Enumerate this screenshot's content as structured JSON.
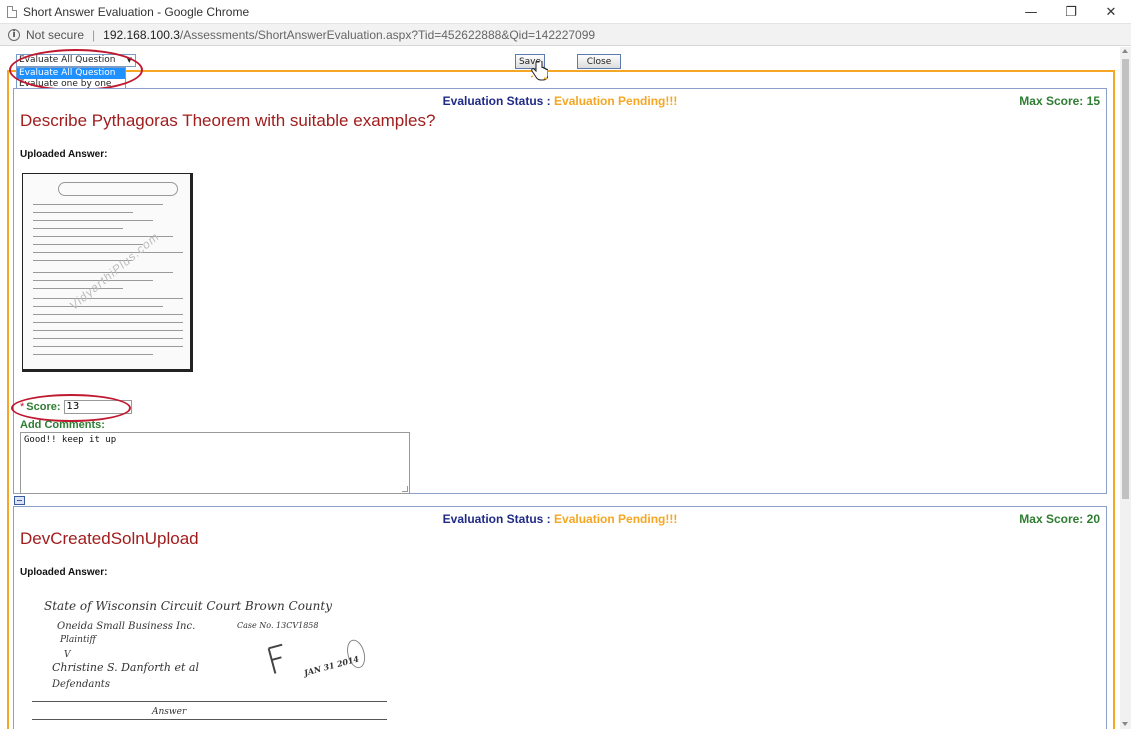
{
  "window": {
    "title": "Short Answer Evaluation - Google Chrome",
    "controls": {
      "minimize": "—",
      "restore": "❐",
      "close": "✕"
    }
  },
  "address": {
    "security": "Not secure",
    "host": "192.168.100.3",
    "path": "/Assessments/ShortAnswerEvaluation.aspx?Tid=452622888&Qid=142227099"
  },
  "toolbar": {
    "mode_selected": "Evaluate All Question",
    "mode_options": [
      "Evaluate All Question",
      "Evaluate one by one"
    ],
    "save_label": "Save",
    "close_label": "Close"
  },
  "questions": [
    {
      "status_label": "Evaluation Status :",
      "status_value": "Evaluation Pending!!!",
      "max_score": "Max Score: 15",
      "title": "Describe Pythagoras Theorem with suitable examples?",
      "uploaded_label": "Uploaded Answer:",
      "watermark": "VidyarthiPlus.com",
      "score_star": "*",
      "score_label": "Score:",
      "score_value": "13",
      "comments_label": "Add Comments:",
      "comments_value": "Good!! keep it up"
    },
    {
      "status_label": "Evaluation Status :",
      "status_value": "Evaluation Pending!!!",
      "max_score": "Max Score: 20",
      "title": "DevCreatedSolnUpload",
      "uploaded_label": "Uploaded Answer:",
      "scan_lines": [
        "State of Wisconsin   Circuit Court   Brown County",
        "Oneida Small Business Inc.",
        "Case No. 13CV1858",
        "Plaintiff",
        "V",
        "Christine S. Danforth et al",
        "Defendants",
        "Answer"
      ],
      "stamp_text": "JAN 31 2014"
    }
  ]
}
